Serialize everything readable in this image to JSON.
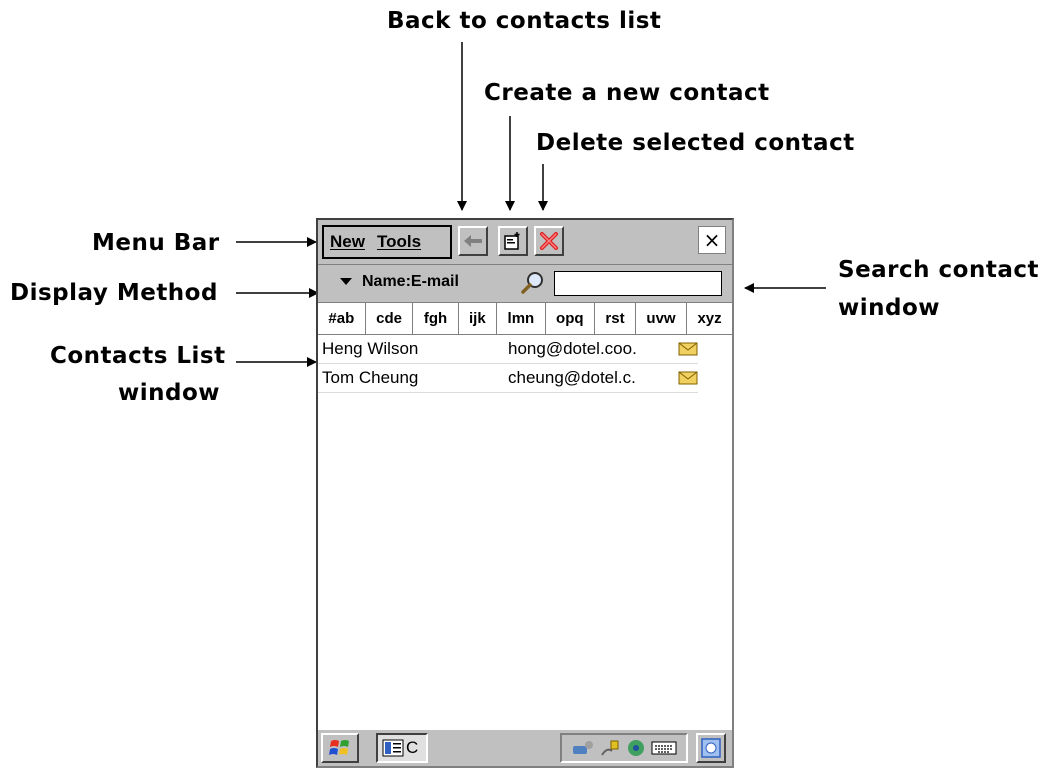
{
  "callouts": {
    "back": "Back to contacts list",
    "create": "Create a new contact",
    "delete": "Delete selected contact",
    "menu_bar": "Menu Bar",
    "display_method": "Display Method",
    "contacts_list_1": "Contacts List",
    "contacts_list_2": "window",
    "search_1": "Search contact",
    "search_2": "window"
  },
  "menu": {
    "new_label": "New",
    "tools_label": "Tools"
  },
  "toolbar": {
    "close_label": "×"
  },
  "display": {
    "method_label": "Name:E-mail",
    "search_value": ""
  },
  "tabs": [
    "#ab",
    "cde",
    "fgh",
    "ijk",
    "lmn",
    "opq",
    "rst",
    "uvw",
    "xyz"
  ],
  "contacts": [
    {
      "name": "Heng Wilson",
      "email": "hong@dotel.coo."
    },
    {
      "name": "Tom Cheung",
      "email": "cheung@dotel.c."
    }
  ],
  "taskbar": {
    "task_label": "C"
  },
  "icons": [
    "start-icon",
    "back-arrow-icon",
    "new-contact-icon",
    "delete-icon",
    "search-icon",
    "envelope-icon",
    "network-icon",
    "power-icon",
    "settings-icon",
    "keyboard-icon",
    "desktop-icon"
  ],
  "colors": {
    "chrome": "#c0c0c0",
    "delete_red": "#e02020",
    "envelope_yellow": "#f0d060"
  }
}
